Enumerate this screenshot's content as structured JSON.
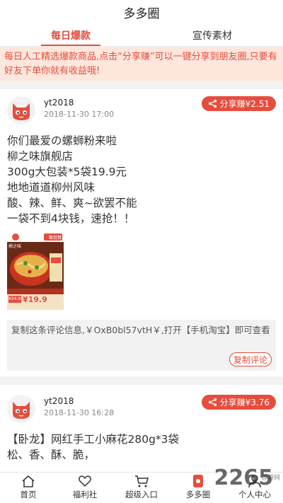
{
  "header": {
    "title": "多多圈"
  },
  "tabs": [
    {
      "label": "每日爆款",
      "active": true
    },
    {
      "label": "宣传素材",
      "active": false
    }
  ],
  "notice": "每日人工精选爆款商品,点击“分享赚”可以一键分享到朋友圈,只要有好友下单你就有收益哦!",
  "posts": [
    {
      "username": "yt2018",
      "time": "2018-11-30 17:00",
      "share_label": "分享赚¥2.51",
      "content_lines": [
        "你们最爱の螺蛳粉来啦",
        "柳之味旗舰店",
        "300g大包装*5袋19.9元",
        "地地道道柳州风味",
        "酸、辣、鲜、爽~欲罢不能",
        "一袋不到4块钱，速抢！！"
      ],
      "image": {
        "brand": "柳之味",
        "badge": "聚划算",
        "price": "¥19.9",
        "old_price": "¥24.9"
      },
      "copy_text": "复制这条评论信息,￥OxB0bl57vtH￥,打开【手机淘宝】即可查看",
      "copy_button": "复制评论"
    },
    {
      "username": "yt2018",
      "time": "2018-11-30 16:28",
      "share_label": "分享赚¥3.76",
      "content_lines": [
        "【卧龙】网红手工小麻花280g*3袋",
        "松、香、酥、脆，"
      ]
    }
  ],
  "bottom_nav": [
    {
      "label": "首页",
      "icon": "home-icon"
    },
    {
      "label": "福利社",
      "icon": "heart-icon"
    },
    {
      "label": "超级入口",
      "icon": "cart-icon"
    },
    {
      "label": "多多圈",
      "icon": "circle-icon"
    },
    {
      "label": "个人中心",
      "icon": "user-icon"
    }
  ],
  "watermark": {
    "main": "2265",
    "site": "香游网",
    "domain": "com"
  },
  "colors": {
    "accent": "#e64d3d",
    "notice_bg": "#fde6dc"
  }
}
